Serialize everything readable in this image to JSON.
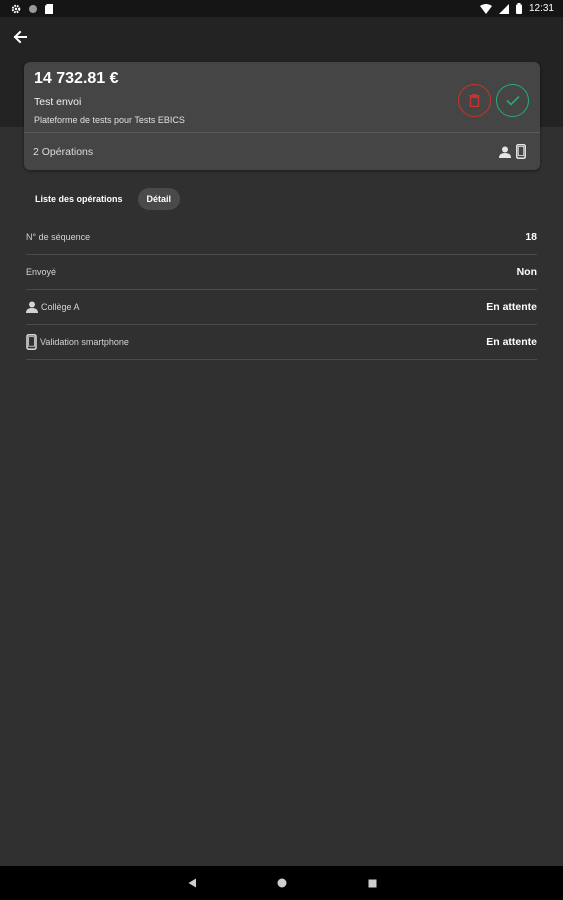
{
  "status_bar": {
    "time": "12:31",
    "left_icons": [
      "gear-icon",
      "circle-icon",
      "sd-card-icon"
    ],
    "right_icons": [
      "wifi-icon",
      "signal-icon",
      "battery-icon"
    ]
  },
  "app_bar": {
    "back_icon": "arrow-left-icon"
  },
  "card": {
    "amount": "14 732.81 €",
    "title": "Test envoi",
    "subtitle": "Plateforme de tests pour Tests EBICS",
    "operations": "2 Opérations",
    "delete_icon": "trash-icon",
    "validate_icon": "check-icon",
    "delete_color": "#c9332f",
    "validate_color": "#2aaa72"
  },
  "tabs": [
    {
      "label": "Liste des opérations",
      "active": false
    },
    {
      "label": "Détail",
      "active": true
    }
  ],
  "details": [
    {
      "label": "N° de séquence",
      "value": "18",
      "icon": null
    },
    {
      "label": "Envoyé",
      "value": "Non",
      "icon": null
    },
    {
      "label": "Collège A",
      "value": "En attente",
      "icon": "person-icon"
    },
    {
      "label": "Validation smartphone",
      "value": "En attente",
      "icon": "smartphone-icon"
    }
  ],
  "nav_bar": {
    "icons": [
      "back-triangle-icon",
      "home-circle-icon",
      "recents-square-icon"
    ]
  }
}
